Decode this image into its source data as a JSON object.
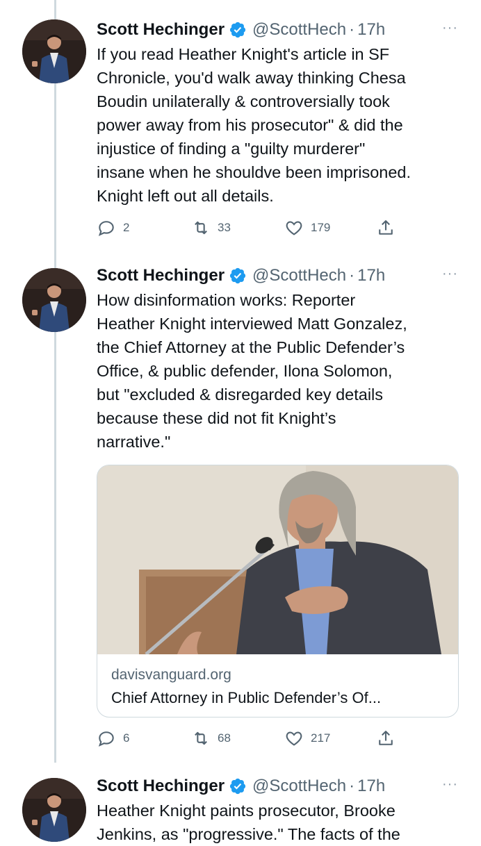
{
  "tweets": [
    {
      "name": "Scott Hechinger",
      "handle": "@ScottHech",
      "time": "17h",
      "text": "If you read Heather Knight's article in SF\nChronicle, you'd walk away thinking Chesa\nBoudin unilaterally & controversially took\npower away from his prosecutor\" & did the\ninjustice of finding a \"guilty murderer\"\ninsane when he shouldve been imprisoned.\nKnight left out all details.",
      "replies": "2",
      "retweets": "33",
      "likes": "179"
    },
    {
      "name": "Scott Hechinger",
      "handle": "@ScottHech",
      "time": "17h",
      "text": "How disinformation works: Reporter\nHeather Knight interviewed Matt Gonzalez,\nthe Chief Attorney at the Public Defender’s\nOffice, & public defender, Ilona Solomon,\nbut \"excluded & disregarded key details\nbecause these did not fit Knight’s\nnarrative.\"",
      "card": {
        "domain": "davisvanguard.org",
        "title": "Chief Attorney in Public Defender’s Of..."
      },
      "replies": "6",
      "retweets": "68",
      "likes": "217"
    },
    {
      "name": "Scott Hechinger",
      "handle": "@ScottHech",
      "time": "17h",
      "text": "Heather Knight paints prosecutor, Brooke\nJenkins, as \"progressive.\" The facts of the"
    }
  ],
  "ui": {
    "more_glyph": "···",
    "dot": "·"
  },
  "colors": {
    "verified": "#1d9bf0",
    "secondary_text": "#536471",
    "thread_line": "#cfd9de"
  }
}
